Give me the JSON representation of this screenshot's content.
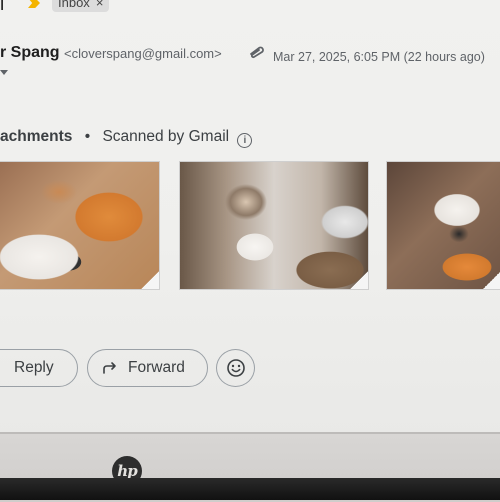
{
  "header": {
    "title_fragment": "l",
    "label_chip": {
      "text": "Inbox",
      "close": "×"
    }
  },
  "message": {
    "sender_name": "r Spang",
    "sender_email": "<cloverspang@gmail.com>",
    "timestamp": "Mar 27, 2025, 6:05 PM (22 hours ago)"
  },
  "attachments": {
    "title": "achments",
    "separator": "•",
    "scan_note": "Scanned by Gmail",
    "info_glyph": "i",
    "thumbnails": [
      {
        "subject": "calico and orange cats sleeping"
      },
      {
        "subject": "calico cat lying on blanket"
      },
      {
        "subject": "calico and orange cats curled together"
      }
    ]
  },
  "actions": {
    "reply_label": "Reply",
    "forward_label": "Forward"
  },
  "device": {
    "brand": "hp"
  },
  "colors": {
    "label_arrow": "#f4b400",
    "text": "#3c4043",
    "muted": "#5f6368"
  }
}
